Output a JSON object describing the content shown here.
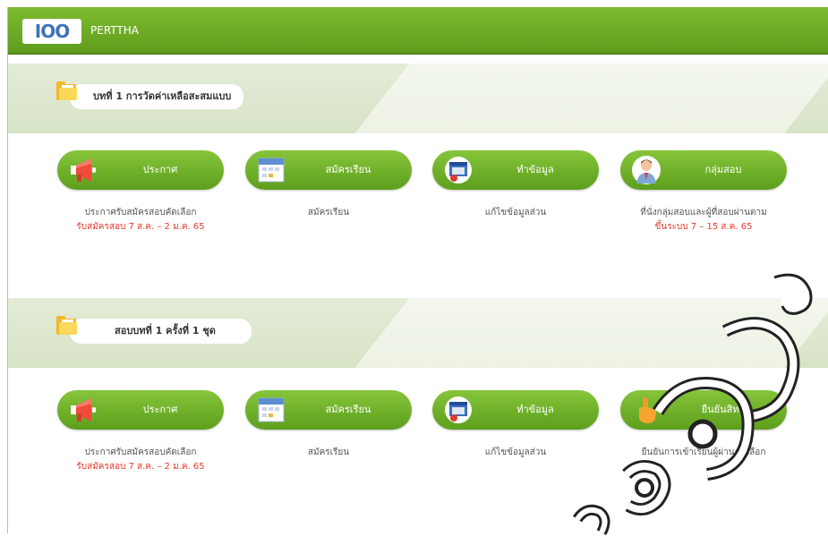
{
  "header": {
    "logo": "IOO",
    "brand": "PERTTHA"
  },
  "sections": [
    {
      "title": "บทที่ 1 การวัดค่าเหลือสะสมแบบ",
      "cards": [
        {
          "label": "ประกาศ",
          "icon": "megaphone-icon",
          "desc": "ประกาศรับสมัครสอบคัดเลือก",
          "red": "รับสมัครสอบ 7 ส.ค. – 2 ม.ค. 65"
        },
        {
          "label": "สมัครเรียน",
          "icon": "calendar-icon",
          "desc": "สมัครเรียน",
          "red": ""
        },
        {
          "label": "ทำข้อมูล",
          "icon": "browser-icon",
          "desc": "แก้ไขข้อมูลส่วน",
          "red": ""
        },
        {
          "label": "กลุ่มสอบ",
          "icon": "person-icon",
          "desc": "ที่นั่งกลุ่มสอบและผู้ที่สอบผ่านตาม",
          "red": "ขึ้นระบบ 7 – 15 ส.ค. 65"
        }
      ]
    },
    {
      "title": "สอบบทที่ 1 ครั้งที่ 1 ชุด",
      "cards": [
        {
          "label": "ประกาศ",
          "icon": "megaphone-icon",
          "desc": "ประกาศรับสมัครสอบคัดเลือก",
          "red": "รับสมัครสอบ 7 ส.ค. – 2 ม.ค. 65"
        },
        {
          "label": "สมัครเรียน",
          "icon": "calendar-icon",
          "desc": "สมัครเรียน",
          "red": ""
        },
        {
          "label": "ทำข้อมูล",
          "icon": "browser-icon",
          "desc": "แก้ไขข้อมูลส่วน",
          "red": ""
        },
        {
          "label": "ยืนยันสิทธิ์",
          "icon": "hand-pointer-icon",
          "desc": "ยืนยันการเข้าเรียนผู้ผ่านคัดเลือก",
          "red": ""
        }
      ]
    }
  ]
}
